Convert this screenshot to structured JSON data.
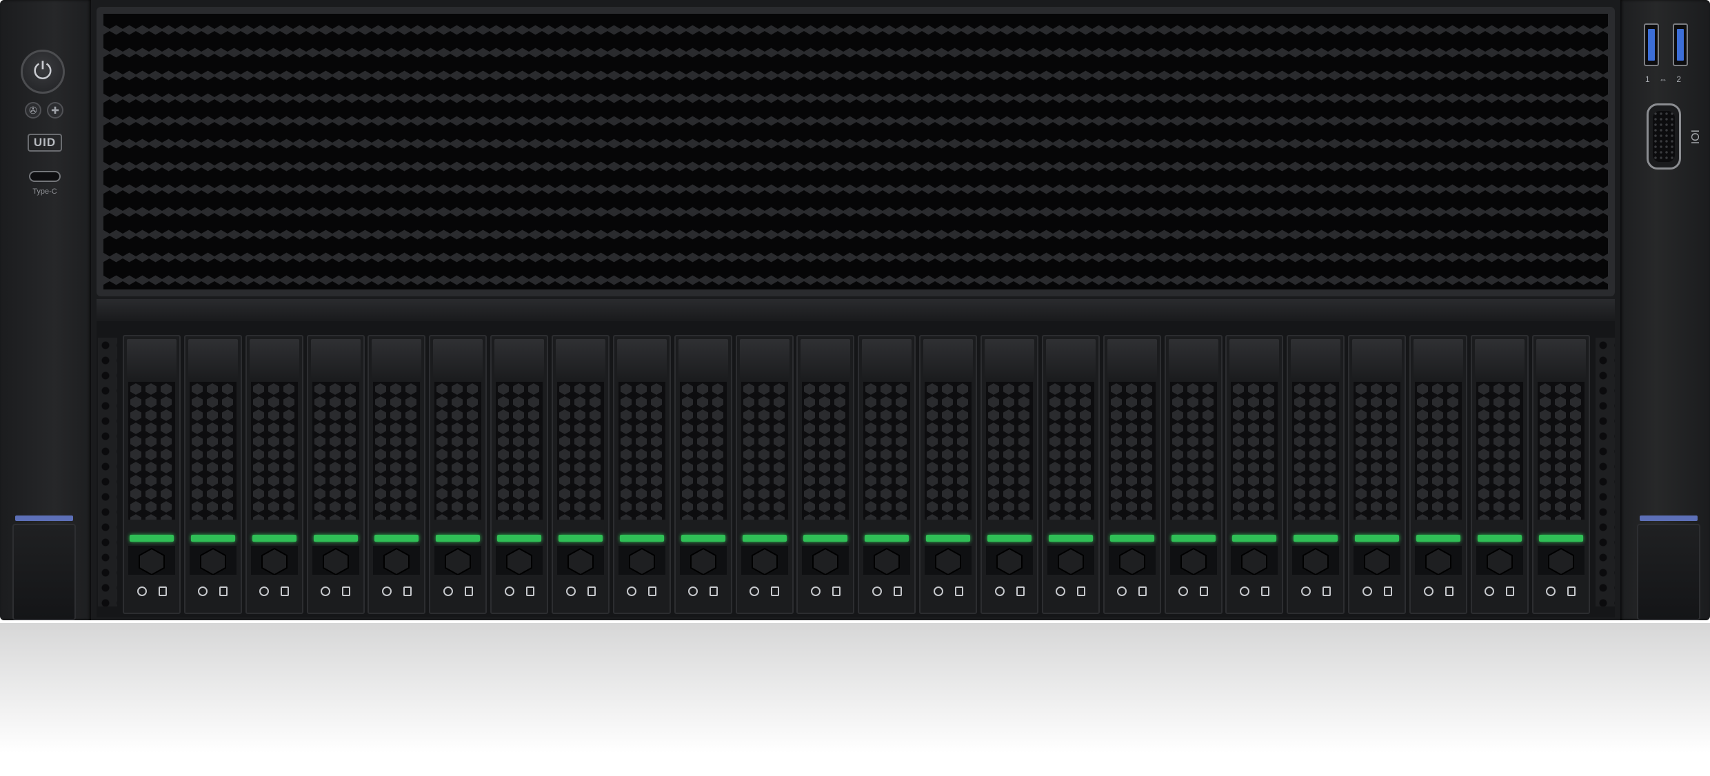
{
  "front_panel": {
    "power_icon": "power-icon",
    "fan_icon": "fan-icon",
    "health_icon": "health-icon",
    "uid_label": "UID",
    "typec_label": "Type-C"
  },
  "right_panel": {
    "usb_port_labels": [
      "1",
      "2"
    ],
    "vga_label": "IOI"
  },
  "drive_bays": {
    "count": 24,
    "led_color": "#2fbf56"
  },
  "colors": {
    "chassis": "#1a1b1d",
    "ear_led": "#5d70b8",
    "usb_blue": "#3c6ed8"
  }
}
